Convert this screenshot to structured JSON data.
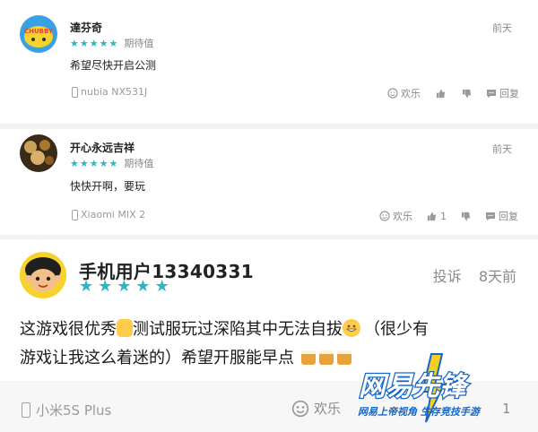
{
  "comments": [
    {
      "user": "達芬奇",
      "rating_text": "期待值",
      "time": "前天",
      "text": "希望尽快开启公测",
      "device": "nubia NX531J",
      "actions": {
        "fun": "欢乐",
        "like_count": "",
        "reply": "回复"
      },
      "avatar_text": "CHUBBY"
    },
    {
      "user": "开心永远吉祥",
      "rating_text": "期待值",
      "time": "前天",
      "text": "快快开啊，要玩",
      "device": "Xiaomi MIX 2",
      "actions": {
        "fun": "欢乐",
        "like_count": "1",
        "reply": "回复"
      }
    },
    {
      "user": "手机用户13340331",
      "time": "8天前",
      "report": "投诉",
      "text_line1_a": "这游戏很优秀",
      "text_line1_b": "测试服玩过深陷其中无法自拔",
      "text_line1_c": "（很少有",
      "text_line2": "游戏让我这么着迷的）希望开服能早点",
      "device": "小米5S Plus",
      "actions": {
        "fun": "欢乐",
        "reply_count": "1"
      }
    }
  ],
  "watermark": {
    "brand": "网易先锋",
    "slogan": "网易上帝视角 生存竞技手游"
  },
  "colors": {
    "star": "#2bb6c6",
    "separator": "#f2f2f4"
  }
}
